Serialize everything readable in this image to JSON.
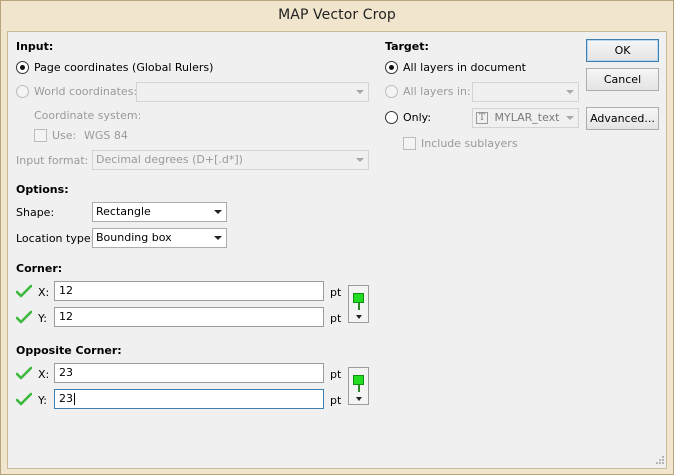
{
  "window": {
    "title": "MAP Vector Crop"
  },
  "input": {
    "heading": "Input:",
    "page_coords_label": "Page coordinates (Global Rulers)",
    "world_coords_label": "World coordinates:",
    "world_coords_value": "",
    "coord_system_label": "Coordinate system:",
    "use_label": "Use:",
    "coord_system_value": "WGS 84",
    "format_label": "Input format:",
    "format_value": "Decimal degrees (D+[.d*])"
  },
  "target": {
    "heading": "Target:",
    "all_layers_doc_label": "All layers in document",
    "all_layers_in_label": "All layers in:",
    "all_layers_in_value": "",
    "only_label": "Only:",
    "only_value": "MYLAR_text",
    "include_sublayers_label": "Include sublayers"
  },
  "buttons": {
    "ok": "OK",
    "cancel": "Cancel",
    "advanced": "Advanced..."
  },
  "options": {
    "heading": "Options:",
    "shape_label": "Shape:",
    "shape_value": "Rectangle",
    "location_label": "Location type:",
    "location_value": "Bounding box"
  },
  "corner": {
    "heading": "Corner:",
    "x_label": "X:",
    "x_value": "12",
    "y_label": "Y:",
    "y_value": "12",
    "unit": "pt"
  },
  "opposite": {
    "heading": "Opposite Corner:",
    "x_label": "X:",
    "x_value": "23",
    "y_label": "Y:",
    "y_value": "23",
    "unit": "pt"
  },
  "colors": {
    "valid_check": "#3cb83c",
    "pin_green": "#22dd22",
    "focus_border": "#3c7fb1"
  }
}
